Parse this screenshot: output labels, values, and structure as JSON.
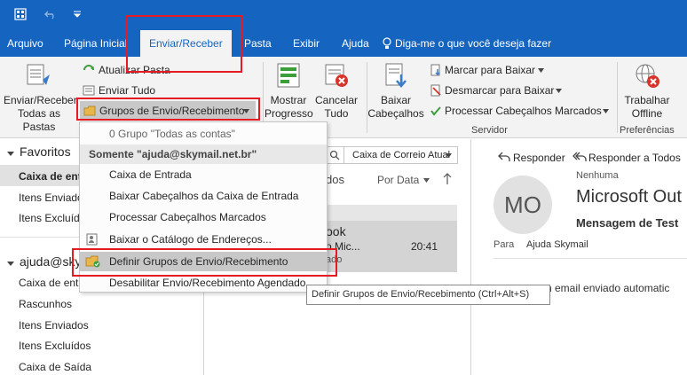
{
  "tabs": [
    "Arquivo",
    "Página Inicial",
    "Enviar/Receber",
    "Pasta",
    "Exibir",
    "Ajuda"
  ],
  "tell_me": "Diga-me o que você deseja fazer",
  "ribbon": {
    "send_receive_all": "Enviar/Receber\nTodas as Pastas",
    "update_folder": "Atualizar Pasta",
    "send_all": "Enviar Tudo",
    "groups": "Grupos de Envio/Recebimento",
    "show_progress": "Mostrar\nProgresso",
    "cancel_all": "Cancelar\nTudo",
    "download_headers": "Baixar\nCabeçalhos",
    "mark_download": "Marcar para Baixar",
    "unmark_download": "Desmarcar para Baixar",
    "process_marked": "Processar Cabeçalhos Marcados",
    "server_label": "Servidor",
    "work_offline": "Trabalhar\nOffline",
    "prefs_label": "Preferências"
  },
  "dropdown": {
    "all_accounts": "0 Grupo \"Todas as contas\"",
    "section": "Somente \"ajuda@skymail.net.br\"",
    "items": [
      "Caixa de Entrada",
      "Baixar Cabeçalhos da Caixa de Entrada",
      "Processar Cabeçalhos Marcados",
      "Baixar o Catálogo de Endereços...",
      "Definir Grupos de Envio/Recebimento",
      "Desabilitar Envio/Recebimento Agendado"
    ]
  },
  "tooltip": "Definir Grupos de Envio/Recebimento (Ctrl+Alt+S)",
  "nav": {
    "favorites": "Favoritos",
    "fav_items": [
      "Caixa de entr",
      "Itens Enviado",
      "Itens Excluído"
    ],
    "account": "ajuda@sky",
    "account_items": [
      "Caixa de entr",
      "Rascunhos",
      "Itens Enviados",
      "Itens Excluídos",
      "Caixa de Saída"
    ]
  },
  "middle": {
    "scope": "Caixa de Correio Atual",
    "all_label": "dos",
    "sort": "Por Data",
    "msg_from": "ook",
    "msg_sub": "o Mic...",
    "msg_time": "20:41",
    "msg_extra": "ado"
  },
  "reading": {
    "reply": "Responder",
    "reply_all": "Responder a Todos",
    "none": "Nenhuma",
    "avatar": "MO",
    "sender": "Microsoft Out",
    "subject": "Mensagem de Test",
    "to_label": "Para",
    "to_value": "Ajuda Skymail",
    "body": "n email enviado automatic"
  },
  "colors": {
    "accent": "#1565c0",
    "highlight": "#e51b24"
  }
}
